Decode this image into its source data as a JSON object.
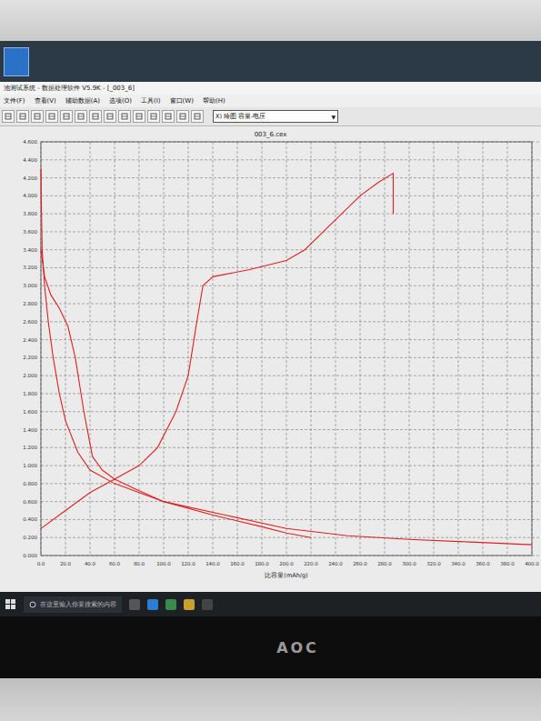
{
  "window": {
    "title": "池测试系统 - 数据处理软件 V5.9K - [_003_6]"
  },
  "menu": [
    "文件(F)",
    "查看(V)",
    "辅助数据(A)",
    "选项(O)",
    "工具(I)",
    "窗口(W)",
    "帮助(H)"
  ],
  "toolbar": {
    "dropdown": {
      "value": "X) 绘图   容量-电压",
      "arrow": "▼"
    }
  },
  "chart": {
    "title": "003_6.cex",
    "x_axis": {
      "title": "比容量(mAh/g)",
      "ticks": [
        "0.0",
        "20.0",
        "40.0",
        "60.0",
        "80.0",
        "100.0",
        "120.0",
        "140.0",
        "160.0",
        "180.0",
        "200.0",
        "220.0",
        "240.0",
        "260.0",
        "280.0",
        "300.0",
        "320.0",
        "340.0",
        "360.0",
        "380.0",
        "400.0"
      ]
    },
    "y_axis": {
      "ticks": [
        "0.000",
        "0.200",
        "0.400",
        "0.600",
        "0.800",
        "1.000",
        "1.200",
        "1.400",
        "1.600",
        "1.800",
        "2.000",
        "2.200",
        "2.400",
        "2.600",
        "2.800",
        "3.000",
        "3.200",
        "3.400",
        "3.600",
        "3.800",
        "4.000",
        "4.200",
        "4.400",
        "4.600"
      ]
    },
    "series": [
      {
        "x": [
          0,
          20,
          40,
          60,
          80,
          95,
          110,
          120,
          127,
          132,
          140,
          170,
          200,
          215,
          230,
          260,
          275,
          287,
          287
        ],
        "y": [
          0.3,
          0.5,
          0.7,
          0.85,
          1.0,
          1.2,
          1.6,
          2.0,
          2.6,
          3.0,
          3.1,
          3.18,
          3.28,
          3.4,
          3.6,
          4.0,
          4.15,
          4.25,
          3.8
        ]
      },
      {
        "x": [
          0,
          0.5,
          1,
          3,
          6,
          10,
          15,
          20,
          30,
          40,
          60,
          100,
          150,
          200,
          250,
          300,
          350,
          400
        ],
        "y": [
          4.3,
          3.8,
          3.4,
          3.0,
          2.6,
          2.2,
          1.8,
          1.5,
          1.15,
          0.95,
          0.8,
          0.6,
          0.45,
          0.3,
          0.22,
          0.18,
          0.15,
          0.12
        ]
      },
      {
        "x": [
          0,
          3,
          8,
          15,
          22,
          28,
          35,
          42,
          50,
          60,
          80,
          100,
          140,
          180,
          200,
          220
        ],
        "y": [
          3.4,
          3.1,
          2.9,
          2.75,
          2.55,
          2.2,
          1.6,
          1.1,
          0.95,
          0.85,
          0.72,
          0.6,
          0.45,
          0.32,
          0.25,
          0.2
        ]
      }
    ]
  },
  "taskbar": {
    "search": "在这里输入你要搜索的内容"
  },
  "monitor": {
    "brand": "AOC"
  }
}
